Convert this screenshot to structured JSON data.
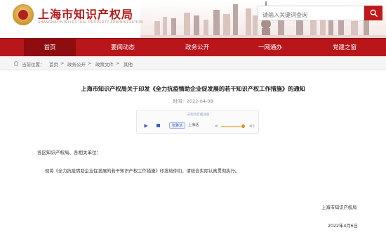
{
  "header": {
    "site_title": "上海市知识产权局",
    "site_subtitle": "SHANGHAI INTELLECTUAL PROPERTY ADMINISTRATION",
    "search_placeholder": "请输入关键词查询"
  },
  "nav": {
    "items": [
      {
        "label": "首页",
        "active": true
      },
      {
        "label": "要闻动态"
      },
      {
        "label": "政务公开"
      },
      {
        "label": "一网通办"
      },
      {
        "label": "党建之窗"
      }
    ]
  },
  "breadcrumb": {
    "prefix": "当前位置：",
    "items": [
      "首页",
      "政务公开",
      "政策文件",
      "其他"
    ],
    "separator": ">"
  },
  "article": {
    "title": "上海市知识产权局关于印发《全力抗疫情助企业促发展的若干知识产权工作措施》的通知",
    "date_label": "时间：",
    "date": "2022-04-08",
    "player": {
      "label": "天聪语音播放器",
      "voice_selected": "张雅洁",
      "voice_other": "上海话"
    },
    "salutation": "各区知识产权局、各相关单位：",
    "body": "现将《全力抗疫情助企业促发展的若干知识产权工作措施》印发给你们，请结合实际认真贯彻执行。",
    "signature": "上海市知识产权局",
    "signature_date": "2022年4月6日"
  },
  "colors": {
    "brand_red": "#b8161a",
    "nav_active": "#8e0d10"
  }
}
